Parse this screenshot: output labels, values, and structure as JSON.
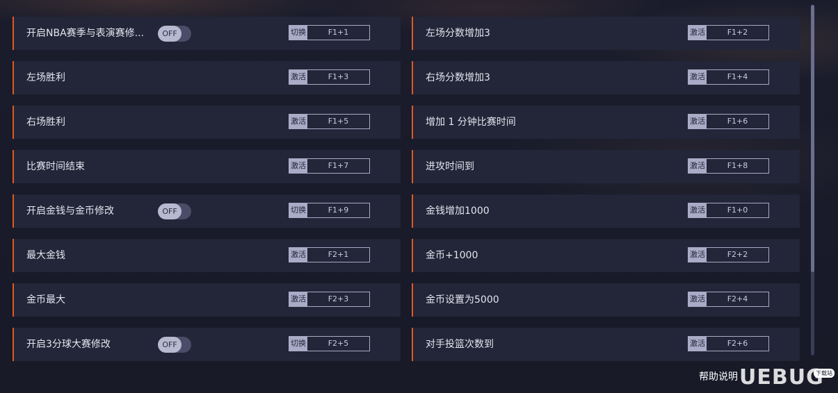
{
  "rows": [
    {
      "label": "开启NBA赛季与表演赛修...",
      "toggle": "OFF",
      "action": "切换",
      "key": "F1+1"
    },
    {
      "label": "左场分数增加3",
      "action": "激活",
      "key": "F1+2"
    },
    {
      "label": "左场胜利",
      "action": "激活",
      "key": "F1+3"
    },
    {
      "label": "右场分数增加3",
      "action": "激活",
      "key": "F1+4"
    },
    {
      "label": "右场胜利",
      "action": "激活",
      "key": "F1+5"
    },
    {
      "label": "增加 1 分钟比赛时间",
      "action": "激活",
      "key": "F1+6"
    },
    {
      "label": "比赛时间结束",
      "action": "激活",
      "key": "F1+7"
    },
    {
      "label": "进攻时间到",
      "action": "激活",
      "key": "F1+8"
    },
    {
      "label": "开启金钱与金币修改",
      "toggle": "OFF",
      "action": "切换",
      "key": "F1+9"
    },
    {
      "label": "金钱增加1000",
      "action": "激活",
      "key": "F1+0"
    },
    {
      "label": "最大金钱",
      "action": "激活",
      "key": "F2+1"
    },
    {
      "label": "金币+1000",
      "action": "激活",
      "key": "F2+2"
    },
    {
      "label": "金币最大",
      "action": "激活",
      "key": "F2+3"
    },
    {
      "label": "金币设置为5000",
      "action": "激活",
      "key": "F2+4"
    },
    {
      "label": "开启3分球大赛修改",
      "toggle": "OFF",
      "action": "切换",
      "key": "F2+5"
    },
    {
      "label": "对手投篮次数到",
      "action": "激活",
      "key": "F2+6"
    }
  ],
  "footer": {
    "help_label": "帮助说明",
    "watermark": "UEBUG",
    "watermark_tag": "下载站"
  },
  "colors": {
    "background": "#191b2b",
    "row_background": "#232538",
    "accent": "#e05a1e",
    "key_tag": "#a9acc6"
  }
}
